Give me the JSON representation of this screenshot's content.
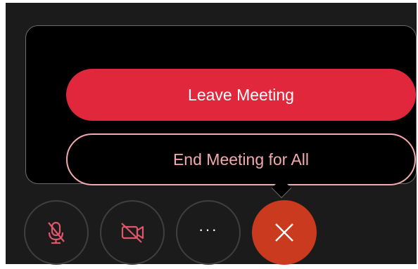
{
  "menu": {
    "leave_label": "Leave Meeting",
    "end_label": "End Meeting for All"
  },
  "controls": {
    "more_label": "···"
  },
  "colors": {
    "accent_red": "#e0273c",
    "end_outline": "#f4a9ad",
    "leave_circle": "#c93a1e",
    "muted_icon": "#e0566a"
  },
  "icons": {
    "mic": "microphone-muted-icon",
    "camera": "video-off-icon",
    "more": "ellipsis-icon",
    "leave": "close-icon"
  }
}
